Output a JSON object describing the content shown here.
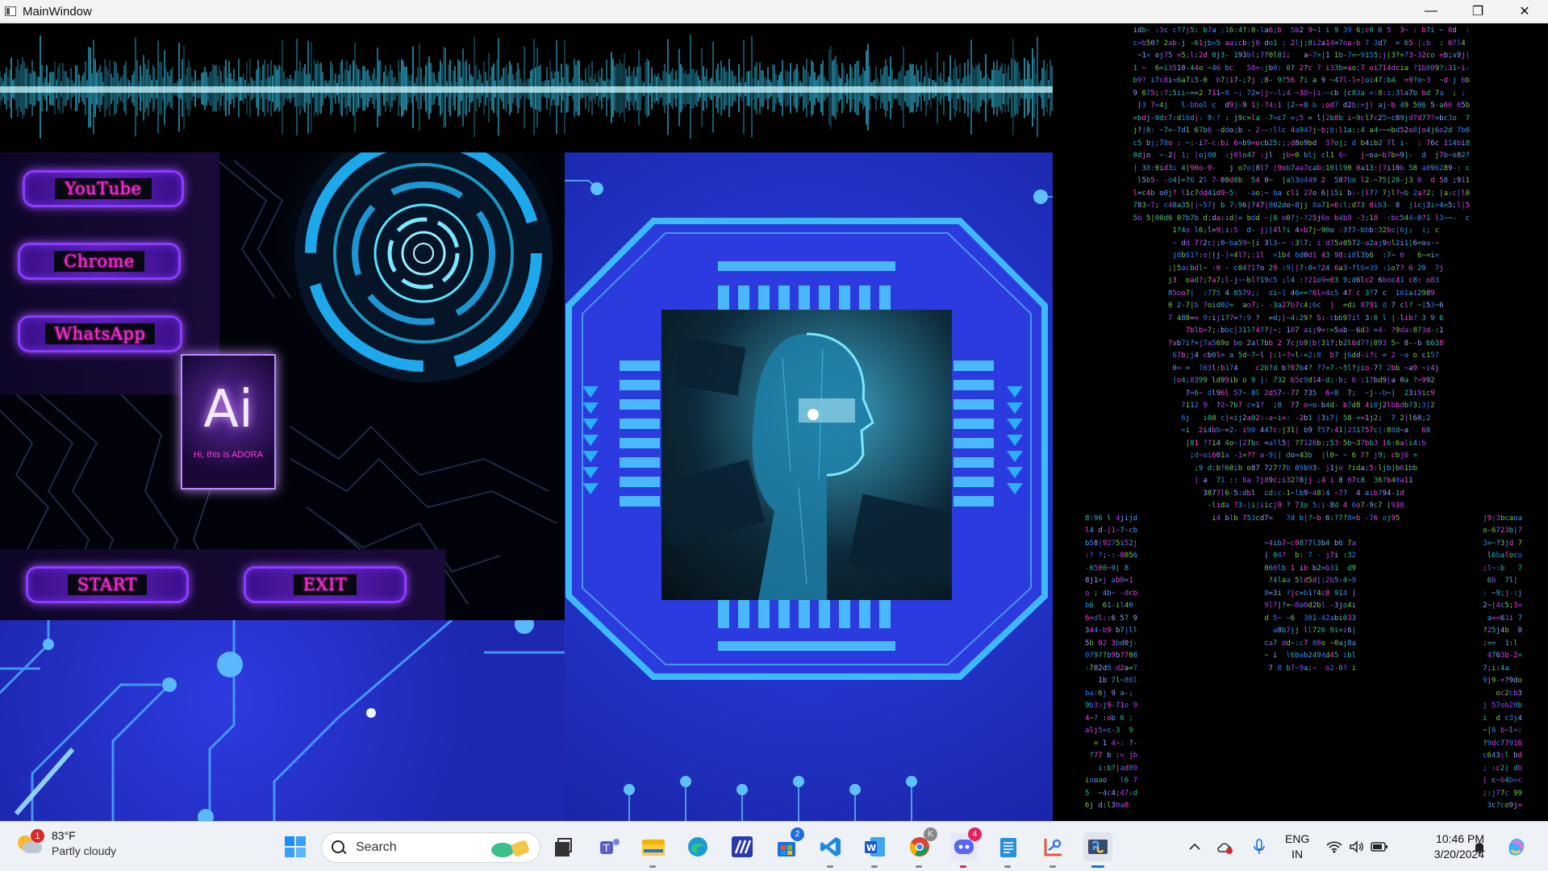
{
  "window": {
    "title": "MainWindow",
    "minimize_label": "—",
    "maximize_label": "❐",
    "close_label": "✕"
  },
  "app": {
    "buttons": {
      "youtube": "YouTube",
      "chrome": "Chrome",
      "whatsapp": "WhatsApp",
      "start": "START",
      "exit": "EXIT"
    },
    "logo_text": "Ai",
    "logo_caption": "Hi, this is ADORA",
    "accent_color": "#ff2bd6",
    "button_border_color": "#8a3cff"
  },
  "taskbar": {
    "weather": {
      "temperature": "83°F",
      "condition": "Partly cloudy",
      "badge": "1"
    },
    "search_label": "Search",
    "apps": [
      {
        "name": "start-menu-icon"
      },
      {
        "name": "file-icon"
      },
      {
        "name": "teams-icon"
      },
      {
        "name": "file-explorer-icon"
      },
      {
        "name": "edge-icon"
      },
      {
        "name": "analytics-icon"
      },
      {
        "name": "store-icon",
        "badge": "2"
      },
      {
        "name": "vscode-icon"
      },
      {
        "name": "word-icon"
      },
      {
        "name": "chrome-icon"
      },
      {
        "name": "discord-icon",
        "badge": "4"
      },
      {
        "name": "notepad-icon"
      },
      {
        "name": "snipping-tool-icon"
      },
      {
        "name": "python-icon"
      }
    ],
    "language": {
      "line1": "ENG",
      "line2": "IN"
    },
    "clock": {
      "time": "10:46 PM",
      "date": "3/20/2024"
    }
  }
}
